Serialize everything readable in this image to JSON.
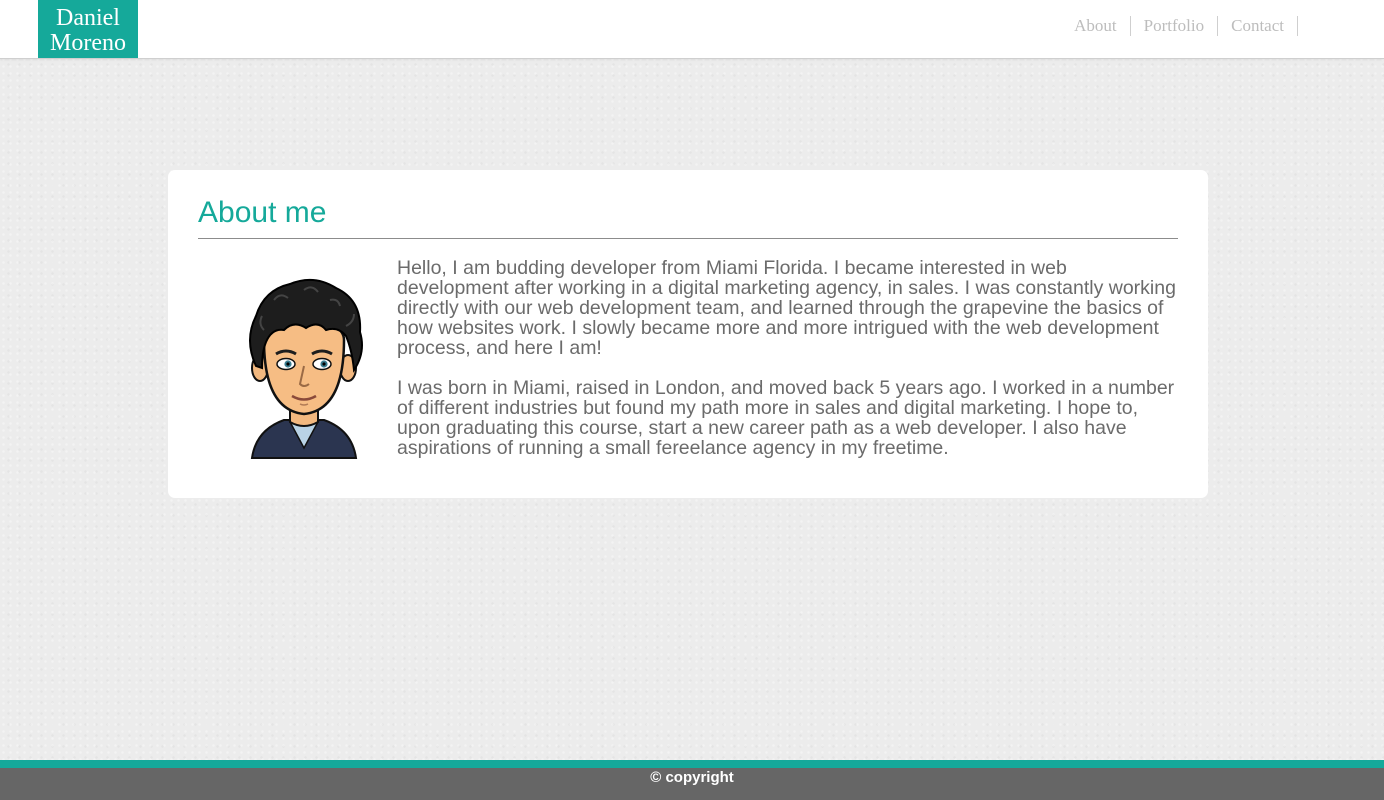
{
  "brand": {
    "line1": "Daniel",
    "line2": "Moreno",
    "color": "#15a99a"
  },
  "nav": [
    {
      "label": "About"
    },
    {
      "label": "Portfolio"
    },
    {
      "label": "Contact"
    }
  ],
  "about": {
    "title": "About me",
    "avatar_icon": "cartoon-avatar",
    "paragraphs": [
      "Hello, I am budding developer from Miami Florida. I became interested in web development after working in a digital marketing agency, in sales. I was constantly working directly with our web development team, and learned through the grapevine the basics of how websites work. I slowly became more and more intrigued with the web development process, and here I am!",
      "I was born in Miami, raised in London, and moved back 5 years ago. I worked in a number of different industries but found my path more in sales and digital marketing. I hope to, upon graduating this course, start a new career path as a web developer. I also have aspirations of running a small fereelance agency in my freetime."
    ]
  },
  "footer": {
    "text": "© copyright",
    "accent_color": "#15a99a",
    "bg_color": "#666666"
  }
}
